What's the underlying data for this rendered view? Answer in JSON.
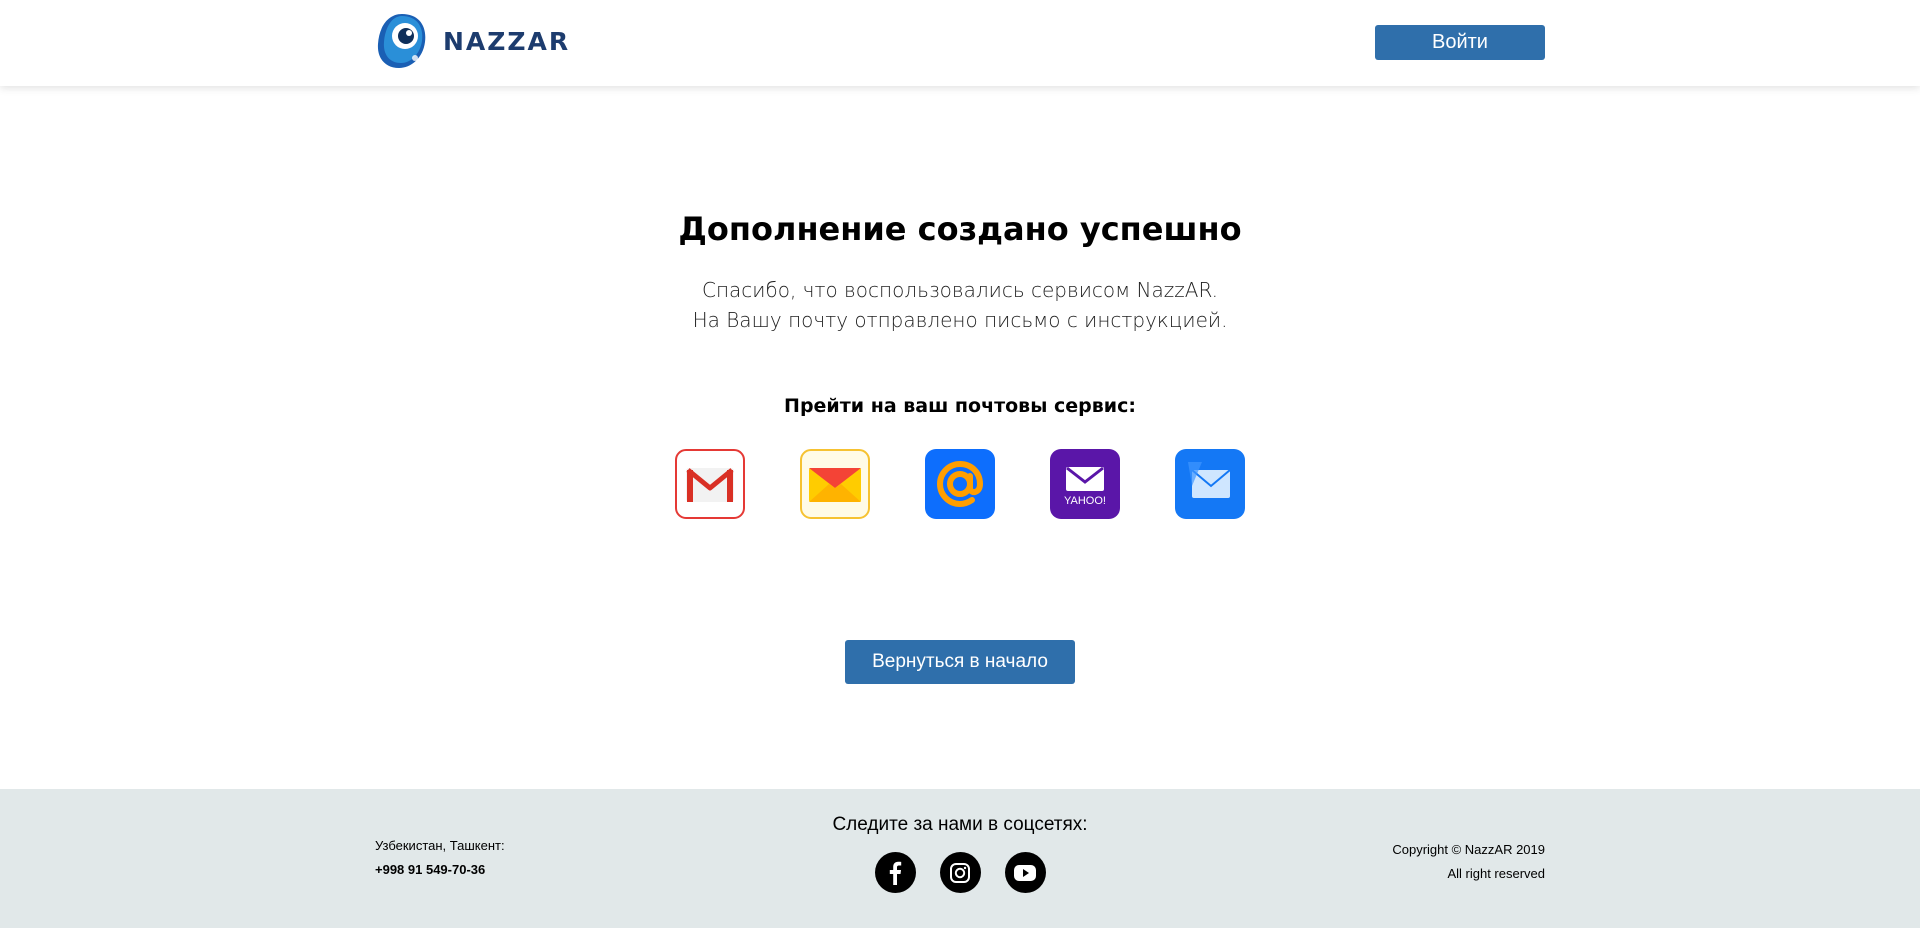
{
  "header": {
    "logo_text": "NAZZAR",
    "login_label": "Войти"
  },
  "main": {
    "title": "Дополнение создано успешно",
    "desc_line1": "Спасибо, что воспользовались сервисом NazzAR.",
    "desc_line2": "На Вашу почту отправлено письмо с инструкцией.",
    "goto_label": "Прейти на ваш почтовы сервис:",
    "mail_services": [
      {
        "name": "gmail-icon"
      },
      {
        "name": "yandex-mail-icon"
      },
      {
        "name": "mail-ru-icon"
      },
      {
        "name": "yahoo-mail-icon"
      },
      {
        "name": "apple-mail-icon"
      }
    ],
    "back_label": "Вернуться в начало"
  },
  "footer": {
    "location": "Узбекистан, Ташкент:",
    "phone": "+998 91 549-70-36",
    "follow_label": "Следите за нами в соцсетях:",
    "copyright": "Copyright © NazzAR 2019",
    "rights": "All right reserved"
  },
  "colors": {
    "primary_button": "#2f6fab",
    "footer_bg": "#e1e8e9",
    "logo_text": "#1d3c6e"
  }
}
